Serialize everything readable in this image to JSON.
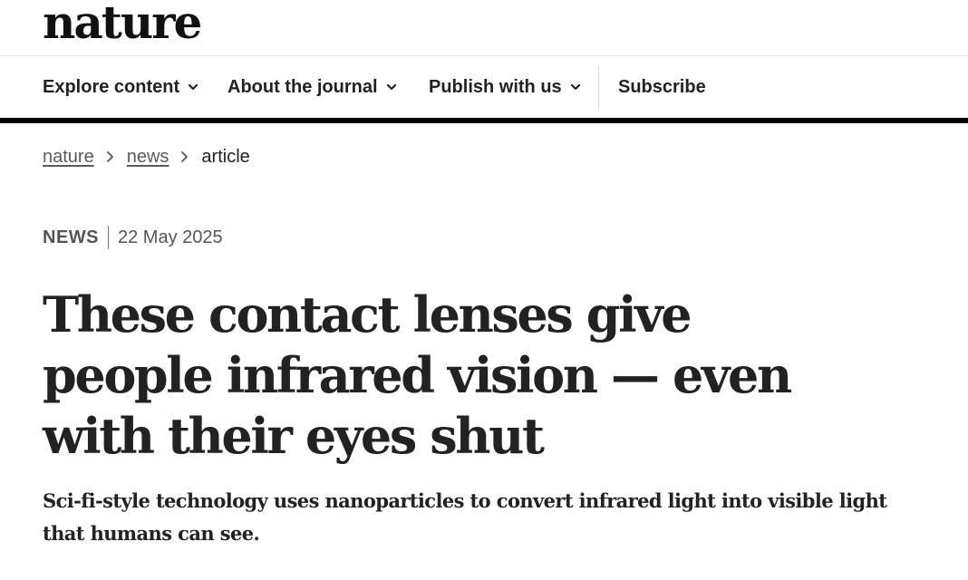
{
  "site": {
    "logo_text": "nature"
  },
  "nav": {
    "items": [
      {
        "label": "Explore content",
        "icon": "chevron-down-icon"
      },
      {
        "label": "About the journal",
        "icon": "chevron-down-icon"
      },
      {
        "label": "Publish with us",
        "icon": "chevron-down-icon"
      }
    ],
    "subscribe_label": "Subscribe"
  },
  "breadcrumb": {
    "items": [
      {
        "label": "nature",
        "link": true
      },
      {
        "label": "news",
        "link": true
      },
      {
        "label": "article",
        "link": false
      }
    ],
    "separator_icon": "chevron-right-icon"
  },
  "article": {
    "type": "NEWS",
    "date": "22 May 2025",
    "title": "These contact lenses give people infrared vision — even with their eyes shut",
    "standfirst": "Sci-fi-style technology uses nanoparticles to convert infrared light into visible light that humans can see."
  },
  "colors": {
    "text": "#222222",
    "muted": "#555555",
    "rule": "#000000",
    "background": "#ffffff"
  }
}
